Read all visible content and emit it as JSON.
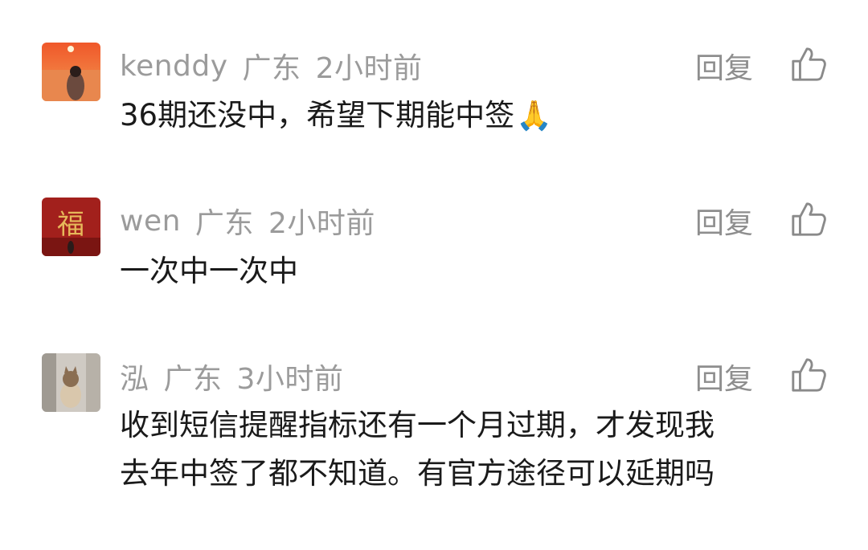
{
  "comments": [
    {
      "username": "kenddy",
      "location": "广东",
      "time": "2小时前",
      "reply_label": "回复",
      "text_lines": [
        "36期还没中，希望下期能中签"
      ],
      "emoji": "🙏",
      "avatar_icon": "avatar-sunset-girl-icon"
    },
    {
      "username": "wen",
      "location": "广东",
      "time": "2小时前",
      "reply_label": "回复",
      "text_lines": [
        "一次中一次中"
      ],
      "avatar_icon": "avatar-fu-icon"
    },
    {
      "username": "泓",
      "location": "广东",
      "time": "3小时前",
      "reply_label": "回复",
      "text_lines": [
        "收到短信提醒指标还有一个月过期，才发现我",
        "去年中签了都不知道。有官方途径可以延期吗"
      ],
      "avatar_icon": "avatar-cat-icon"
    }
  ],
  "colors": {
    "meta": "#9b9b9b",
    "text": "#1a1a1a",
    "reply": "#8e8e8e"
  },
  "icons": {
    "like": "thumbs-up-icon"
  }
}
